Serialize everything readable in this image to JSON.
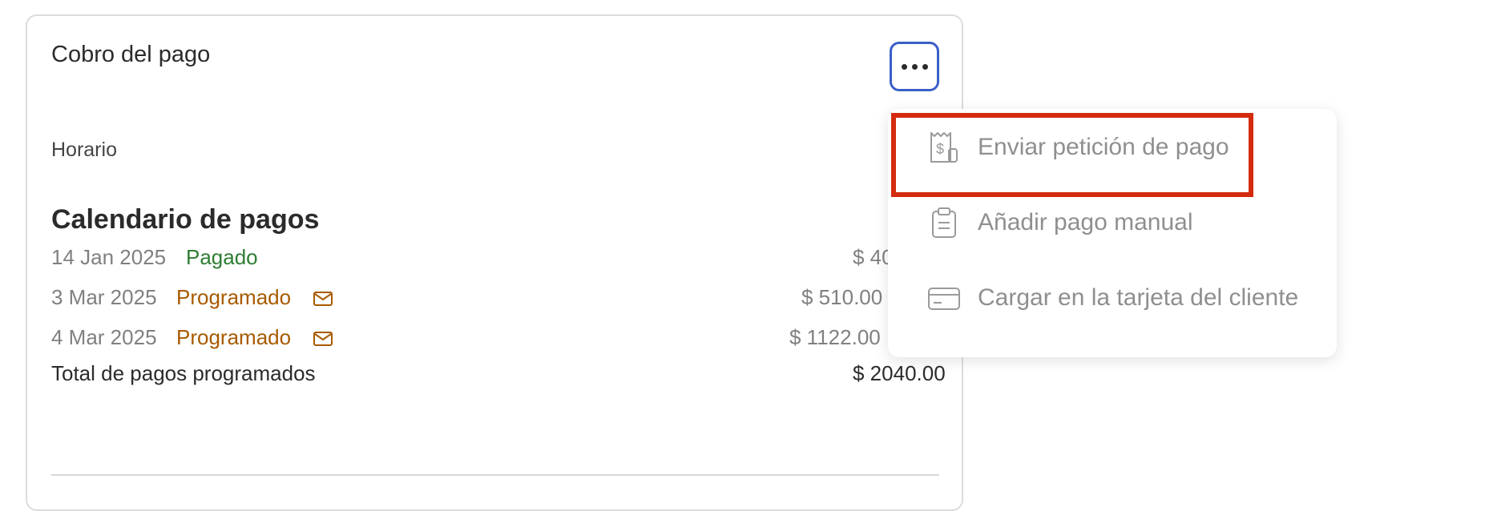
{
  "card": {
    "title": "Cobro del pago",
    "section_label": "Horario",
    "schedule_title": "Calendario de pagos",
    "payments": [
      {
        "date": "14 Jan 2025",
        "status": "Pagado",
        "amount": "$ 40"
      },
      {
        "date": "3 Mar 2025",
        "status": "Programado",
        "amount": "$ 510.00",
        "has_mail_icon": true
      },
      {
        "date": "4 Mar 2025",
        "status": "Programado",
        "amount": "$ 1122.00",
        "has_mail_icon": true
      }
    ],
    "total_label": "Total de pagos programados",
    "total_amount": "$ 2040.00"
  },
  "menu": {
    "items": [
      {
        "label": "Enviar petición de pago",
        "icon": "receipt-dollar-icon",
        "highlighted": true
      },
      {
        "label": "Añadir pago manual",
        "icon": "clipboard-icon"
      },
      {
        "label": "Cargar en la tarjeta del cliente",
        "icon": "credit-card-icon"
      }
    ]
  },
  "colors": {
    "paid": "#2e7d32",
    "scheduled": "#a85a00",
    "focus_ring": "#3a5fc8",
    "highlight": "#d42a0e"
  }
}
